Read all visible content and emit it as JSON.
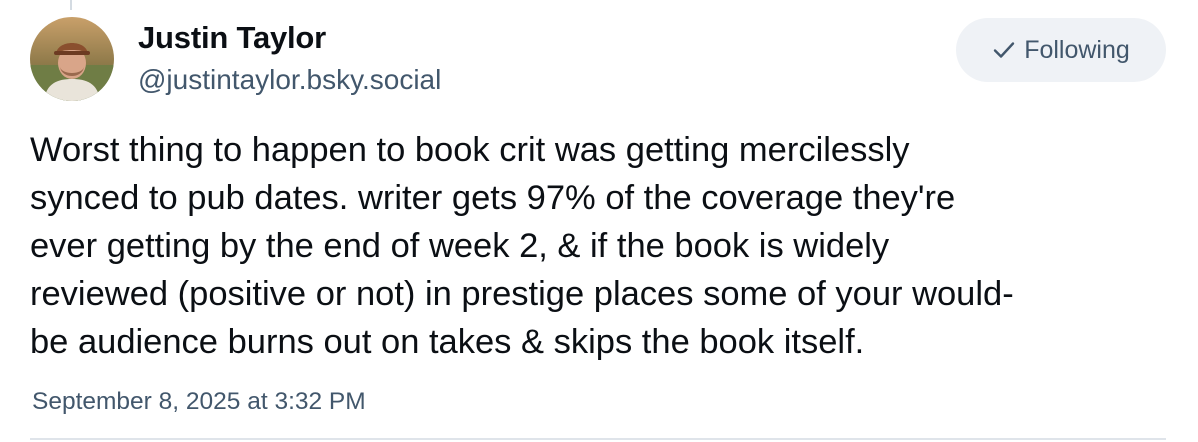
{
  "author": {
    "display_name": "Justin Taylor",
    "handle": "@justintaylor.bsky.social",
    "avatar_icon": "person-photo-avatar"
  },
  "follow_button": {
    "label": "Following",
    "icon": "checkmark-icon"
  },
  "post": {
    "lines": [
      "Worst thing to happen to book crit was getting mercilessly",
      "synced to pub dates. writer gets 97% of the coverage they're",
      "ever getting by the end of week 2, & if the book is widely",
      "reviewed (positive or not) in prestige places some of your would-",
      "be audience burns out on takes & skips the book itself."
    ],
    "timestamp": "September 8, 2025 at 3:32 PM"
  },
  "colors": {
    "text_primary": "#0b0f14",
    "text_secondary": "#42576c",
    "button_bg": "#eff2f6",
    "divider": "#dfe4ea"
  }
}
